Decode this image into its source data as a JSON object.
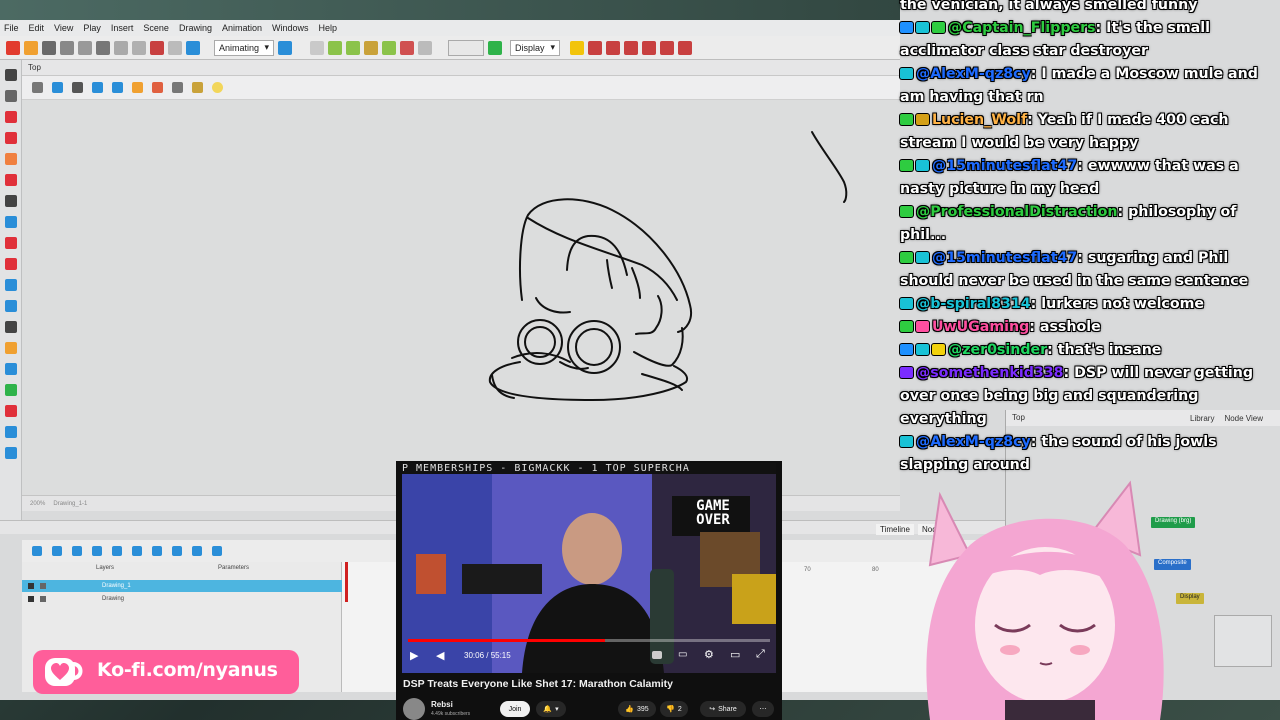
{
  "app": {
    "menu": [
      "File",
      "Edit",
      "View",
      "Play",
      "Insert",
      "Scene",
      "Drawing",
      "Animation",
      "Windows",
      "Help"
    ],
    "workspace_dropdown": "Animating",
    "display_dropdown": "Display",
    "view_tab": "Top",
    "statusbar_zoom": "200%",
    "statusbar_drawing": "Drawing_1-1",
    "timeline_tab": "Timeline",
    "node_tab": "Node",
    "layers_header": "Layers",
    "params_header": "Parameters",
    "layers": [
      {
        "name": "Drawing_1",
        "selected": true
      },
      {
        "name": "Drawing",
        "selected": false
      }
    ],
    "frame_numbers": [
      "70",
      "80"
    ],
    "node_view": {
      "tabs": [
        "Library",
        "Node View"
      ],
      "tab_label": "Top",
      "nodes": [
        "Drawing (brg)",
        "Composite",
        "Display"
      ]
    }
  },
  "chat": {
    "messages": [
      {
        "user": "",
        "user_color": "#ffffff",
        "text": "the venician, it always smelled funny",
        "badges": []
      },
      {
        "user": "@Captain_Flippers",
        "user_color": "#2ecc40",
        "text": "It's the small acclimator class star destroyer",
        "badges": [
          "#1e90ff",
          "#19c2d6",
          "#2ecc40"
        ]
      },
      {
        "user": "@AlexM-qz8cy",
        "user_color": "#1e6bff",
        "text": "I made a Moscow mule and am having that rn",
        "badges": [
          "#19c2d6"
        ]
      },
      {
        "user": "Lucien_Wolf",
        "user_color": "#ffb347",
        "text": "Yeah if I made 400 each stream I would be very happy",
        "badges": [
          "#2ecc40",
          "#d4a017"
        ]
      },
      {
        "user": "@15minutesflat47",
        "user_color": "#1e6bff",
        "text": "ewwww that was a nasty picture in my head",
        "badges": [
          "#2ecc40",
          "#19c2d6"
        ]
      },
      {
        "user": "@ProfessionalDistraction",
        "user_color": "#2ecc40",
        "text": "philosophy of phil...",
        "badges": [
          "#2ecc40"
        ]
      },
      {
        "user": "@15minutesflat47",
        "user_color": "#1e6bff",
        "text": "sugaring and Phil should never be used in the same sentence",
        "badges": [
          "#2ecc40",
          "#19c2d6"
        ]
      },
      {
        "user": "@b-spiral8314",
        "user_color": "#19c2d6",
        "text": "lurkers not welcome",
        "badges": [
          "#19c2d6"
        ]
      },
      {
        "user": "UwUGaming",
        "user_color": "#ff4fa0",
        "text": "asshole",
        "badges": [
          "#2ecc40",
          "#ff4fa0"
        ]
      },
      {
        "user": "@zer0sinder",
        "user_color": "#1ed760",
        "text": "that's insane",
        "badges": [
          "#1e90ff",
          "#19c2d6",
          "#f2d20c"
        ]
      },
      {
        "user": "@somethenkid338",
        "user_color": "#7b2cff",
        "text": "DSP will never getting over once being big and squandering everything",
        "badges": [
          "#7b2cff"
        ]
      },
      {
        "user": "@AlexM-qz8cy",
        "user_color": "#1e6bff",
        "text": "the sound of his jowls slapping around",
        "badges": [
          "#19c2d6"
        ]
      }
    ]
  },
  "youtube": {
    "ticker": "P MEMBERSHIPS - BIGMACKK - 1   TOP SUPERCHA",
    "game_over_text": "GAME OVER",
    "time": "30:06 / 55:15",
    "progress": 0.545,
    "title": "DSP Treats Everyone Like Shet 17: Marathon Calamity",
    "channel": "Rebsi",
    "subscribers": "4.49k subscribers",
    "join_label": "Join",
    "likes": "395",
    "dislikes": "2",
    "share_label": "Share"
  },
  "kofi": {
    "text": "Ko-fi.com/nyanus",
    "color": "#ff5e9a"
  }
}
